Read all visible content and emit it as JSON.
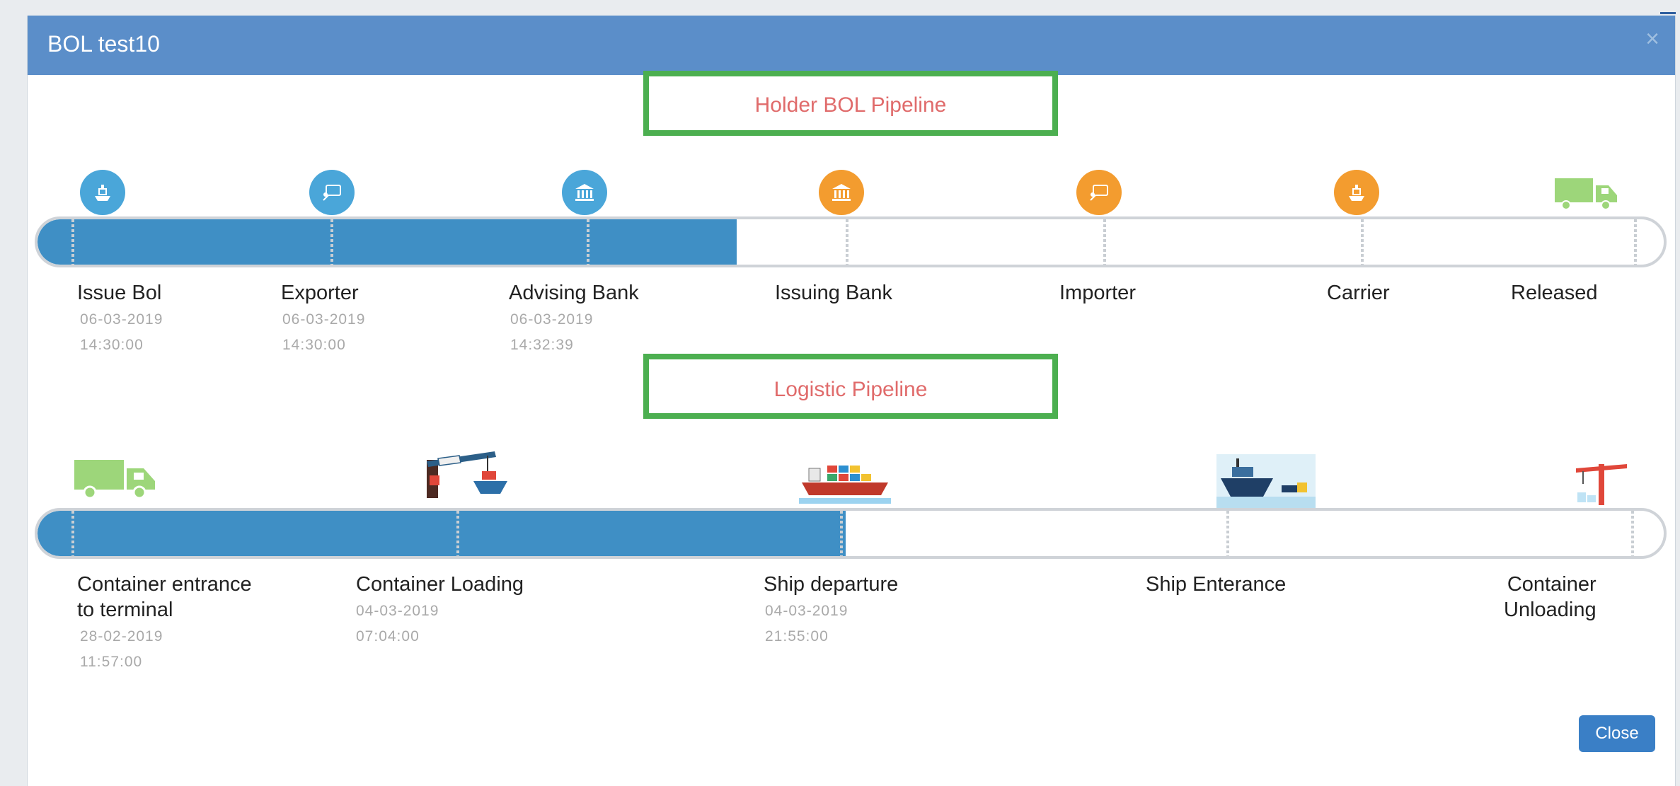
{
  "modal": {
    "title": "BOL test10",
    "close_symbol": "×",
    "close_button": "Close"
  },
  "holder": {
    "title": "Holder BOL Pipeline",
    "progress": 0.43,
    "stages": [
      {
        "label": "Issue Bol",
        "date": "06-03-2019",
        "time": "14:30:00",
        "icon": "ship-holder-icon",
        "status": "done"
      },
      {
        "label": "Exporter",
        "date": "06-03-2019",
        "time": "14:30:00",
        "icon": "exporter-icon",
        "status": "done"
      },
      {
        "label": "Advising Bank",
        "date": "06-03-2019",
        "time": "14:32:39",
        "icon": "bank-icon",
        "status": "done"
      },
      {
        "label": "Issuing Bank",
        "date": "",
        "time": "",
        "icon": "bank-icon",
        "status": "pending"
      },
      {
        "label": "Importer",
        "date": "",
        "time": "",
        "icon": "importer-icon",
        "status": "pending"
      },
      {
        "label": "Carrier",
        "date": "",
        "time": "",
        "icon": "ship-carrier-icon",
        "status": "pending"
      },
      {
        "label": "Released",
        "date": "",
        "time": "",
        "icon": "truck-icon",
        "status": "pending"
      }
    ],
    "colors": {
      "done": "#4aa6d9",
      "pending": "#f39c2f",
      "fill": "#3f8fc5"
    }
  },
  "logistic": {
    "title": "Logistic Pipeline",
    "progress": 0.497,
    "stages": [
      {
        "label_line1": "Container entrance",
        "label_line2": "to terminal",
        "date": "28-02-2019",
        "time": "11:57:00",
        "icon": "truck-icon"
      },
      {
        "label_line1": "Container Loading",
        "label_line2": "",
        "date": "04-03-2019",
        "time": "07:04:00",
        "icon": "crane-loading-icon"
      },
      {
        "label_line1": "Ship departure",
        "label_line2": "",
        "date": "04-03-2019",
        "time": "21:55:00",
        "icon": "cargo-ship-icon"
      },
      {
        "label_line1": "Ship Enterance",
        "label_line2": "",
        "date": "",
        "time": "",
        "icon": "ship-entrance-icon"
      },
      {
        "label_line1": "Container",
        "label_line2": "Unloading",
        "date": "",
        "time": "",
        "icon": "crane-unloading-icon"
      }
    ]
  }
}
